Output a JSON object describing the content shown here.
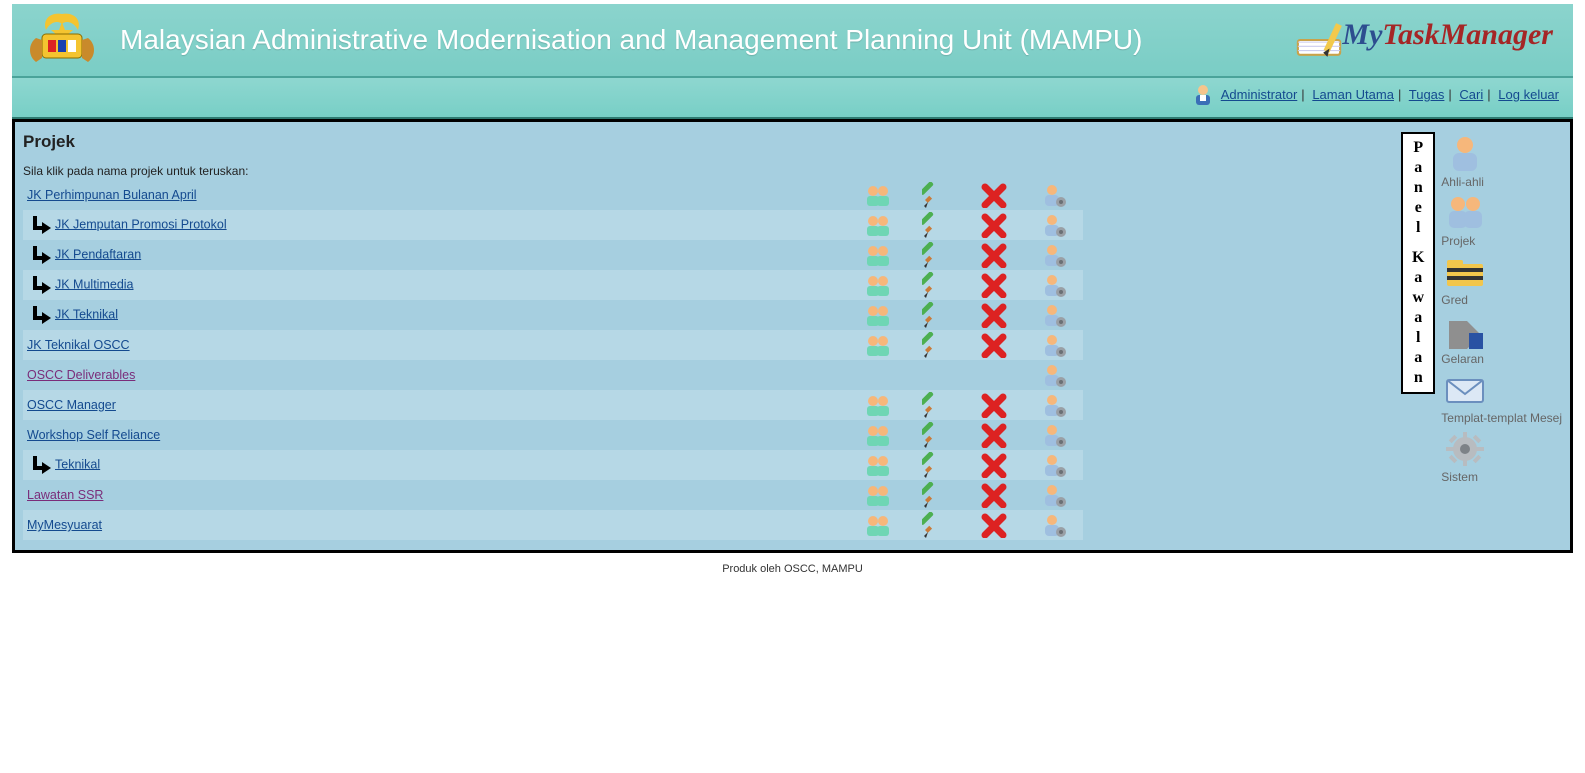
{
  "header": {
    "title": "Malaysian Administrative Modernisation and Management Planning Unit (MAMPU)",
    "brandMy": "My",
    "brandTask": "TaskManager"
  },
  "nav": {
    "admin": "Administrator",
    "home": "Laman Utama",
    "tasks": "Tugas",
    "search": "Cari",
    "logout": "Log keluar"
  },
  "page": {
    "heading": "Projek",
    "hint": "Sila klik pada nama projek untuk teruskan:"
  },
  "projects": [
    {
      "name": "JK Perhimpunan Bulanan April",
      "child": false,
      "visited": false,
      "hasTeam": true,
      "hasEdit": true,
      "hasDelete": true,
      "hasUser": true
    },
    {
      "name": "JK Jemputan Promosi Protokol",
      "child": true,
      "visited": false,
      "hasTeam": true,
      "hasEdit": true,
      "hasDelete": true,
      "hasUser": true
    },
    {
      "name": "JK Pendaftaran",
      "child": true,
      "visited": false,
      "hasTeam": true,
      "hasEdit": true,
      "hasDelete": true,
      "hasUser": true
    },
    {
      "name": "JK Multimedia",
      "child": true,
      "visited": false,
      "hasTeam": true,
      "hasEdit": true,
      "hasDelete": true,
      "hasUser": true
    },
    {
      "name": "JK Teknikal",
      "child": true,
      "visited": false,
      "hasTeam": true,
      "hasEdit": true,
      "hasDelete": true,
      "hasUser": true
    },
    {
      "name": "JK Teknikal OSCC",
      "child": false,
      "visited": false,
      "hasTeam": true,
      "hasEdit": true,
      "hasDelete": true,
      "hasUser": true,
      "sameRow": true
    },
    {
      "name": "OSCC Deliverables",
      "child": false,
      "visited": true,
      "hasTeam": false,
      "hasEdit": false,
      "hasDelete": false,
      "hasUser": true
    },
    {
      "name": "OSCC Manager",
      "child": false,
      "visited": false,
      "hasTeam": true,
      "hasEdit": true,
      "hasDelete": true,
      "hasUser": true
    },
    {
      "name": "Workshop Self Reliance",
      "child": false,
      "visited": false,
      "hasTeam": true,
      "hasEdit": true,
      "hasDelete": true,
      "hasUser": true
    },
    {
      "name": "Teknikal",
      "child": true,
      "visited": false,
      "hasTeam": true,
      "hasEdit": true,
      "hasDelete": true,
      "hasUser": true
    },
    {
      "name": "Lawatan SSR",
      "child": false,
      "visited": true,
      "hasTeam": true,
      "hasEdit": true,
      "hasDelete": true,
      "hasUser": true,
      "sameRow": true
    },
    {
      "name": "MyMesyuarat",
      "child": false,
      "visited": false,
      "hasTeam": true,
      "hasEdit": true,
      "hasDelete": true,
      "hasUser": true
    }
  ],
  "panel": {
    "title": "Panel Kawalan",
    "items": [
      {
        "label": "Ahli-ahli",
        "icon": "user"
      },
      {
        "label": "Projek",
        "icon": "users"
      },
      {
        "label": "Gred",
        "icon": "folder"
      },
      {
        "label": "Gelaran",
        "icon": "tag"
      },
      {
        "label": "Templat-templat Mesej",
        "icon": "mail"
      },
      {
        "label": "Sistem",
        "icon": "gear"
      }
    ]
  },
  "footer": "Produk oleh OSCC, MAMPU"
}
